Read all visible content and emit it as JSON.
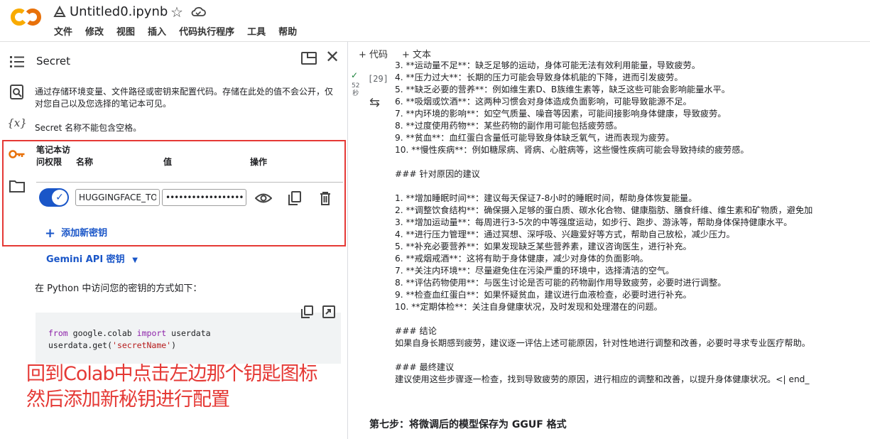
{
  "header": {
    "notebook_title": "Untitled0.ipynb",
    "menu": [
      "文件",
      "修改",
      "视图",
      "插入",
      "代码执行程序",
      "工具",
      "帮助"
    ]
  },
  "rail_icons": [
    "toc-icon",
    "search-code-icon",
    "variables-icon",
    "key-icon",
    "folder-icon"
  ],
  "secrets_panel": {
    "title": "Secret",
    "description": "通过存储环境变量、文件路径或密钥来配置代码。存储在此处的值不会公开，仅对您自己以及您选择的笔记本可见。",
    "name_rule": "Secret 名称不能包含空格。",
    "table_headers": {
      "access": "笔记本访问权限",
      "name": "名称",
      "value": "值",
      "actions": "操作"
    },
    "secret": {
      "enabled": true,
      "name": "HUGGINGFACE_TOKEN",
      "value": "••••••••••••••••••••••••••••"
    },
    "add_secret_label": "添加新密钥",
    "gemini_link": "Gemini API 密钥",
    "python_access_text": "在 Python 中访问您的密钥的方式如下：",
    "code": {
      "line1": {
        "kw1": "from",
        "mod": "google.colab",
        "kw2": "import",
        "name": "userdata"
      },
      "line2": {
        "prefix": "userdata.get(",
        "arg": "'secretName'",
        "suffix": ")"
      }
    }
  },
  "annotation": {
    "line1": "回到Colab中点击左边那个钥匙图标",
    "line2": "然后添加新秘钥进行配置",
    "color": "#e53935"
  },
  "notebook": {
    "add_code": "+ 代码",
    "add_text": "+ 文本",
    "cell_check": "✓",
    "cell_time": "52\n秒",
    "exec_count": "[29]",
    "output_lines": [
      "3. **运动量不足**：缺乏足够的运动，身体可能无法有效利用能量，导致疲劳。",
      "4. **压力过大**：长期的压力可能会导致身体机能的下降，进而引发疲劳。",
      "5. **缺乏必要的营养**：例如维生素D、B族维生素等，缺乏这些可能会影响能量水平。",
      "6. **吸烟或饮酒**：这两种习惯会对身体造成负面影响，可能导致能源不足。",
      "7. **内环境的影响**：如空气质量、噪音等因素，可能间接影响身体健康，导致疲劳。",
      "8. **过度使用药物**：某些药物的副作用可能包括疲劳感。",
      "9. **贫血**：血红蛋白含量低可能导致身体缺乏氧气，进而表现为疲劳。",
      "10. **慢性疾病**：例如糖尿病、肾病、心脏病等，这些慢性疾病可能会导致持续的疲劳感。",
      "",
      "### 针对原因的建议",
      "",
      "1. **增加睡眠时间**：建议每天保证7-8小时的睡眠时间，帮助身体恢复能量。",
      "2. **调整饮食结构**：确保摄入足够的蛋白质、碳水化合物、健康脂肪、膳食纤维、维生素和矿物质，避免加",
      "3. **增加运动量**：每周进行3-5次的中等强度运动，如步行、跑步、游泳等，帮助身体保持健康水平。",
      "4. **进行压力管理**：通过冥想、深呼吸、兴趣爱好等方式，帮助自己放松，减少压力。",
      "5. **补充必要营养**：如果发现缺乏某些营养素，建议咨询医生，进行补充。",
      "6. **戒烟戒酒**：这将有助于身体健康，减少对身体的负面影响。",
      "7. **关注内环境**：尽量避免住在污染严重的环境中，选择清洁的空气。",
      "8. **评估药物使用**：与医生讨论是否可能的药物副作用导致疲劳，必要时进行调整。",
      "9. **检查血红蛋白**：如果怀疑贫血，建议进行血液检查，必要时进行补充。",
      "10. **定期体检**：关注自身健康状况，及时发现和处理潜在的问题。",
      "",
      "### 结论",
      "如果自身长期感到疲劳，建议逐一评估上述可能原因，针对性地进行调整和改善，必要时寻求专业医疗帮助。",
      "",
      "### 最终建议",
      "建议使用这些步骤逐一检查，找到导致疲劳的原因，进行相应的调整和改善，以提升身体健康状况。<| end_"
    ],
    "step7_heading": "第七步：将微调后的模型保存为 GGUF 格式"
  }
}
